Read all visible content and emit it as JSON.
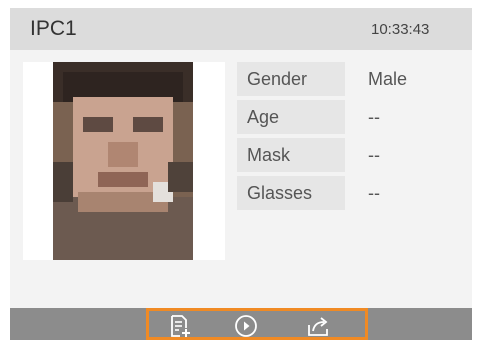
{
  "header": {
    "channel": "IPC1",
    "time": "10:33:43"
  },
  "attributes": [
    {
      "label": "Gender",
      "value": "Male"
    },
    {
      "label": "Age",
      "value": "--"
    },
    {
      "label": "Mask",
      "value": "--"
    },
    {
      "label": "Glasses",
      "value": "--"
    }
  ],
  "toolbar": {
    "icons": [
      "add-to-list-icon",
      "play-icon",
      "export-icon"
    ],
    "highlight_color": "#f08a24"
  },
  "colors": {
    "header_bg": "#dcdcdc",
    "card_bg": "#f3f3f3",
    "label_bg": "#e6e6e6",
    "toolbar_bg": "#8c8c8c"
  }
}
